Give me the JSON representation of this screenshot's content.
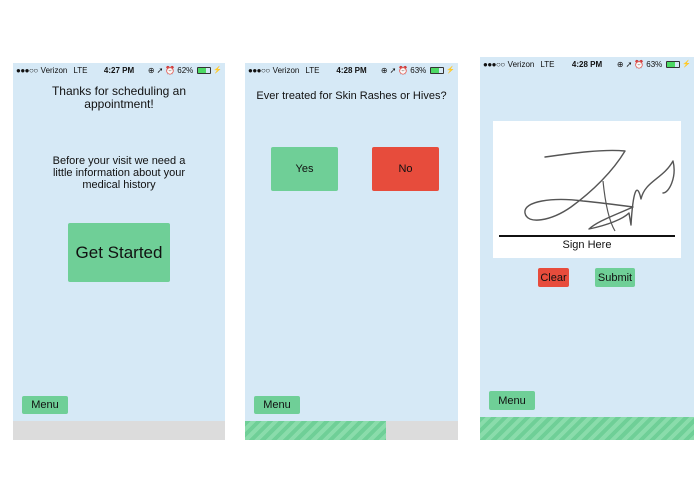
{
  "status_bars": [
    {
      "dots": "●●●○○",
      "carrier": "Verizon",
      "network": "LTE",
      "time": "4:27 PM",
      "battery": "62%",
      "battery_level": 0.62
    },
    {
      "dots": "●●●○○",
      "carrier": "Verizon",
      "network": "LTE",
      "time": "4:28 PM",
      "battery": "63%",
      "battery_level": 0.63
    },
    {
      "dots": "●●●○○",
      "carrier": "Verizon",
      "network": "LTE",
      "time": "4:28 PM",
      "battery": "63%",
      "battery_level": 0.63
    }
  ],
  "screen1": {
    "thanks_text": "Thanks for scheduling an appointment!",
    "info_text": "Before your visit we need a little information about your medical history",
    "get_started_label": "Get Started",
    "menu_label": "Menu",
    "progress": 0
  },
  "screen2": {
    "question": "Ever treated for Skin Rashes or Hives?",
    "yes_label": "Yes",
    "no_label": "No",
    "menu_label": "Menu",
    "progress": 0.66
  },
  "screen3": {
    "sign_label": "Sign Here",
    "clear_label": "Clear",
    "submit_label": "Submit",
    "menu_label": "Menu",
    "progress": 1
  },
  "colors": {
    "screen_bg": "#d6e9f6",
    "green": "#6fcf97",
    "red": "#e74c3c",
    "footer": "#dcdcdc"
  },
  "icons": [
    "signal-dots-icon",
    "lock-rotation-icon",
    "location-arrow-icon",
    "alarm-icon",
    "battery-icon",
    "charging-bolt-icon"
  ]
}
